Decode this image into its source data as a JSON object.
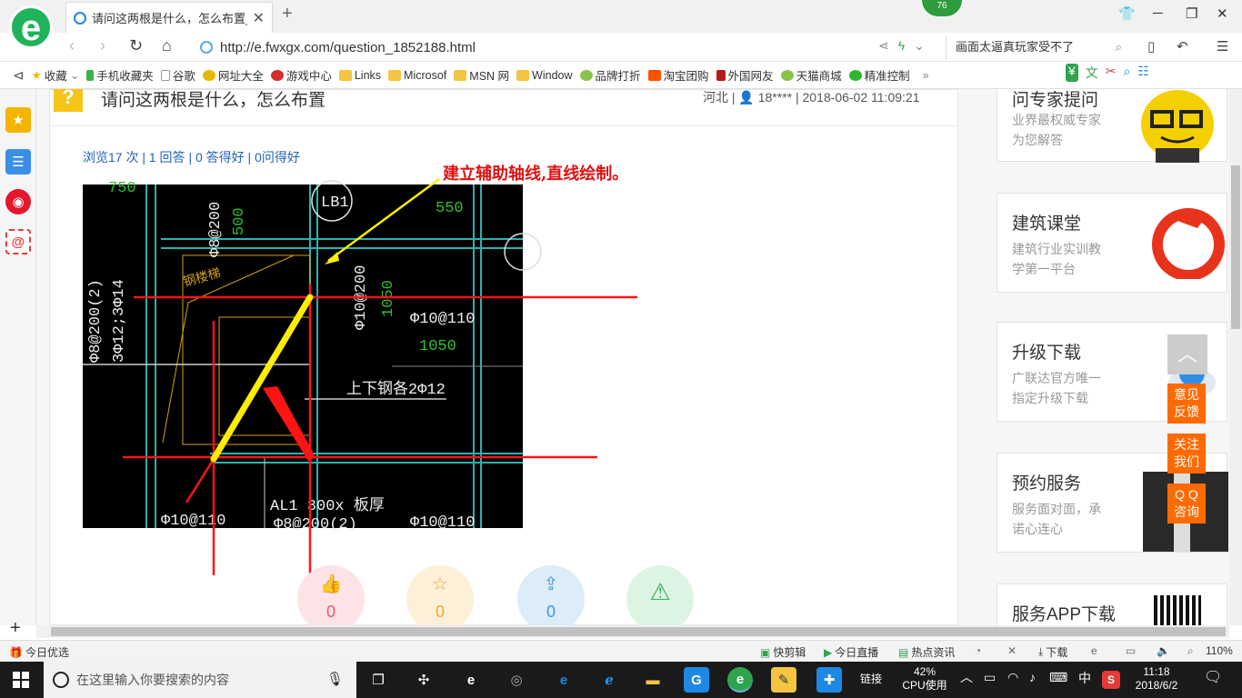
{
  "browser": {
    "tab_title": "请问这两根是什么，怎么布置_广",
    "new_tab": "+",
    "badge_count": "76",
    "url": "http://e.fwxgx.com/question_1852188.html",
    "search_text": "画面太逼真玩家受不了"
  },
  "bookmarks": [
    "收藏",
    "手机收藏夹",
    "谷歌",
    "网址大全",
    "游戏中心",
    "Links",
    "Microsof",
    "MSN 网",
    "Window",
    "品牌打折",
    "淘宝团购",
    "外国网友",
    "天猫商城",
    "精准控制"
  ],
  "question": {
    "title": "请问这两根是什么，怎么布置",
    "meta": "河北 | 👤 18**** | 2018-06-02 11:09:21",
    "stats": "浏览17 次 | 1 回答 | 0 答得好 | 0问得好",
    "annotation": "建立辅助轴线,直线绘制。"
  },
  "drawing_labels": {
    "lb1": "LB1",
    "v750": "750",
    "v550": "550",
    "v500": "500",
    "phi8_200": "Φ8@200",
    "phi10_200": "Φ10@200",
    "v1050a": "1050",
    "phi10_110a": "Φ10@110",
    "v1050b": "1050",
    "stair": "钢楼梯",
    "phi8_200_2": "Φ8@200(2)",
    "bars3": "3Φ12;3Φ14",
    "updown": "上下钢各2Φ12",
    "al1": "AL1 300x 板厚",
    "phi8_200_2b": "Φ8@200(2)",
    "phi10_110b": "Φ10@110",
    "phi10_110c": "Φ10@110"
  },
  "actions": [
    {
      "icon": "thumbs-up",
      "count": "0",
      "color": "#fde3e6",
      "fg": "#e85a6c"
    },
    {
      "icon": "star",
      "count": "0",
      "color": "#fdf0d8",
      "fg": "#f0a830"
    },
    {
      "icon": "share",
      "count": "0",
      "color": "#dcecf9",
      "fg": "#3f98e0"
    },
    {
      "icon": "warning",
      "count": "",
      "color": "#ddf4e3",
      "fg": "#3fb65a"
    }
  ],
  "sidebar_cards": [
    {
      "title": "问专家提问",
      "desc1": "业界最权威专家",
      "desc2": "为您解答"
    },
    {
      "title": "建筑课堂",
      "desc1": "建筑行业实训教",
      "desc2": "学第一平台"
    },
    {
      "title": "升级下载",
      "desc1": "广联达官方唯一",
      "desc2": "指定升级下载"
    },
    {
      "title": "预约服务",
      "desc1": "服务面对面，承",
      "desc2": "诺心连心"
    },
    {
      "title": "服务APP下载",
      "desc1": "",
      "desc2": ""
    }
  ],
  "float_buttons": [
    "意见\n反馈",
    "关注\n我们",
    "Q Q\n咨询"
  ],
  "statusbar": {
    "left": "今日优选",
    "items": [
      "快剪辑",
      "今日直播",
      "热点资讯",
      "下载"
    ],
    "zoom": "110%"
  },
  "taskbar": {
    "search_placeholder": "在这里输入你要搜索的内容",
    "link_label": "链接",
    "cpu_percent": "42%",
    "cpu_label": "CPU使用",
    "ime": "中",
    "time": "11:18",
    "date": "2018/6/2"
  }
}
